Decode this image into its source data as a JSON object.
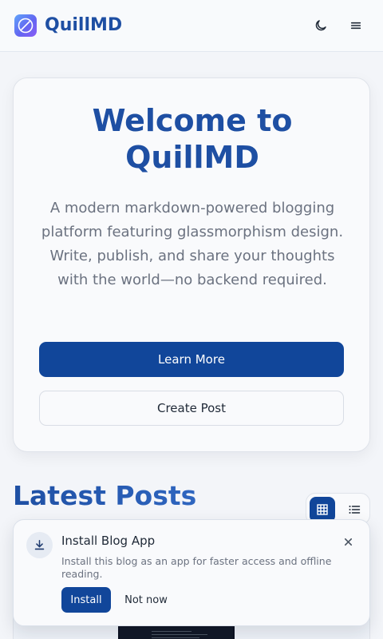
{
  "header": {
    "brand": "QuillMD",
    "logo_icon": "quill-icon",
    "theme_icon": "moon-icon",
    "menu_icon": "menu-icon"
  },
  "hero": {
    "title": "Welcome to QuillMD",
    "description": "A modern markdown-powered blogging platform featuring glassmorphism design. Write, publish, and share your thoughts with the world—no backend required.",
    "primary_label": "Learn More",
    "secondary_label": "Create Post"
  },
  "latest": {
    "title": "Latest Posts",
    "view_modes": [
      "grid-icon",
      "list-icon"
    ],
    "active_view": "grid"
  },
  "install_prompt": {
    "title": "Install Blog App",
    "description": "Install this blog as an app for faster access and offline reading.",
    "install_label": "Install",
    "dismiss_label": "Not now",
    "icon": "download-icon",
    "close_icon": "close-icon"
  },
  "colors": {
    "brand": "#1e4fa3",
    "primary_button": "#11469a",
    "muted_text": "#6b7280"
  }
}
